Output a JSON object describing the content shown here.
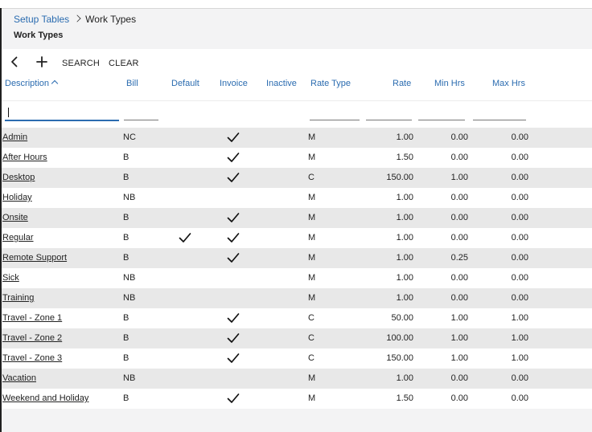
{
  "breadcrumb": {
    "parent": "Setup Tables",
    "current": "Work Types"
  },
  "page": {
    "title": "Work Types"
  },
  "toolbar": {
    "search_label": "SEARCH",
    "clear_label": "CLEAR",
    "back_icon": "chevron-left-icon",
    "add_icon": "plus-icon"
  },
  "columns": {
    "description": "Description",
    "bill": "Bill",
    "default": "Default",
    "invoice": "Invoice",
    "inactive": "Inactive",
    "rate_type": "Rate Type",
    "rate": "Rate",
    "min_hrs": "Min Hrs",
    "max_hrs": "Max Hrs"
  },
  "sort": {
    "column": "description",
    "direction": "ascending"
  },
  "filters": {
    "description": "",
    "bill": "",
    "rate_type": "",
    "rate": "",
    "min_hrs": "",
    "max_hrs": ""
  },
  "colors": {
    "accent": "#2b6cb0",
    "row_alt": "#e8e8e8",
    "page_bg": "#f3f3f4"
  },
  "rows": [
    {
      "description": "Admin",
      "bill": "NC",
      "default": false,
      "invoice": true,
      "inactive": false,
      "rate_type": "M",
      "rate": "1.00",
      "min_hrs": "0.00",
      "max_hrs": "0.00"
    },
    {
      "description": "After Hours",
      "bill": "B",
      "default": false,
      "invoice": true,
      "inactive": false,
      "rate_type": "M",
      "rate": "1.50",
      "min_hrs": "0.00",
      "max_hrs": "0.00"
    },
    {
      "description": "Desktop",
      "bill": "B",
      "default": false,
      "invoice": true,
      "inactive": false,
      "rate_type": "C",
      "rate": "150.00",
      "min_hrs": "1.00",
      "max_hrs": "0.00"
    },
    {
      "description": "Holiday",
      "bill": "NB",
      "default": false,
      "invoice": false,
      "inactive": false,
      "rate_type": "M",
      "rate": "1.00",
      "min_hrs": "0.00",
      "max_hrs": "0.00"
    },
    {
      "description": "Onsite",
      "bill": "B",
      "default": false,
      "invoice": true,
      "inactive": false,
      "rate_type": "M",
      "rate": "1.00",
      "min_hrs": "0.00",
      "max_hrs": "0.00"
    },
    {
      "description": "Regular",
      "bill": "B",
      "default": true,
      "invoice": true,
      "inactive": false,
      "rate_type": "M",
      "rate": "1.00",
      "min_hrs": "0.00",
      "max_hrs": "0.00"
    },
    {
      "description": "Remote Support",
      "bill": "B",
      "default": false,
      "invoice": true,
      "inactive": false,
      "rate_type": "M",
      "rate": "1.00",
      "min_hrs": "0.25",
      "max_hrs": "0.00"
    },
    {
      "description": "Sick",
      "bill": "NB",
      "default": false,
      "invoice": false,
      "inactive": false,
      "rate_type": "M",
      "rate": "1.00",
      "min_hrs": "0.00",
      "max_hrs": "0.00"
    },
    {
      "description": "Training",
      "bill": "NB",
      "default": false,
      "invoice": false,
      "inactive": false,
      "rate_type": "M",
      "rate": "1.00",
      "min_hrs": "0.00",
      "max_hrs": "0.00"
    },
    {
      "description": "Travel - Zone 1",
      "bill": "B",
      "default": false,
      "invoice": true,
      "inactive": false,
      "rate_type": "C",
      "rate": "50.00",
      "min_hrs": "1.00",
      "max_hrs": "1.00"
    },
    {
      "description": "Travel - Zone 2",
      "bill": "B",
      "default": false,
      "invoice": true,
      "inactive": false,
      "rate_type": "C",
      "rate": "100.00",
      "min_hrs": "1.00",
      "max_hrs": "1.00"
    },
    {
      "description": "Travel - Zone 3",
      "bill": "B",
      "default": false,
      "invoice": true,
      "inactive": false,
      "rate_type": "C",
      "rate": "150.00",
      "min_hrs": "1.00",
      "max_hrs": "1.00"
    },
    {
      "description": "Vacation",
      "bill": "NB",
      "default": false,
      "invoice": false,
      "inactive": false,
      "rate_type": "M",
      "rate": "1.00",
      "min_hrs": "0.00",
      "max_hrs": "0.00"
    },
    {
      "description": "Weekend and Holiday",
      "bill": "B",
      "default": false,
      "invoice": true,
      "inactive": false,
      "rate_type": "M",
      "rate": "1.50",
      "min_hrs": "0.00",
      "max_hrs": "0.00"
    }
  ]
}
